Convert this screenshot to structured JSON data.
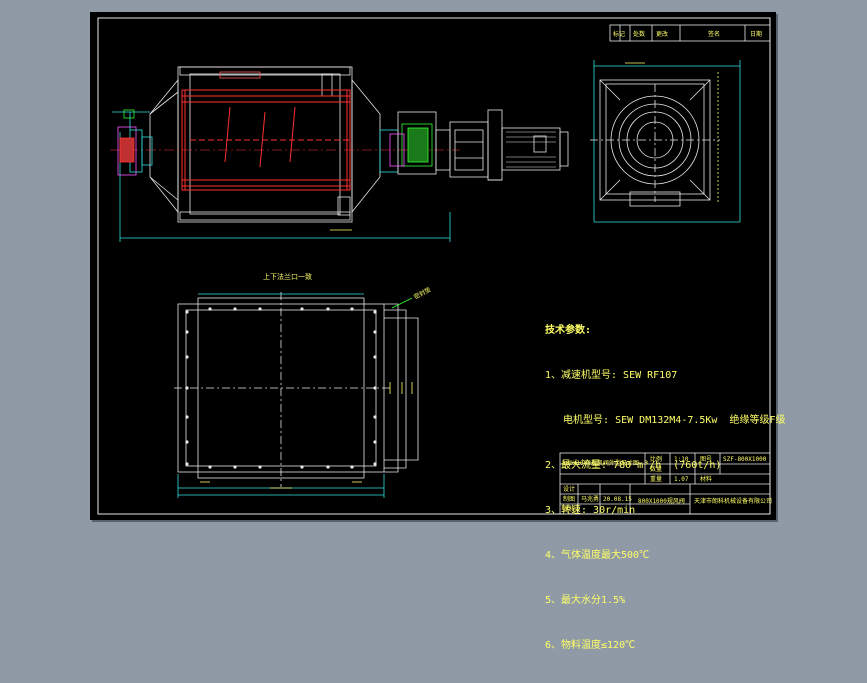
{
  "drawing": {
    "flange_caption": "上下法兰口一致",
    "seal_caption": "密封垫",
    "tech_params": {
      "title": "技术参数:",
      "lines": [
        "1、减速机型号: SEW RF107",
        "   电机型号: SEW DM132M4-7.5Kw  绝缘等级F级",
        "2、最大流量: 780 m³/h  (760t/h)",
        "3、转速: 30r/min",
        "4、气体温度最大500℃",
        "5、最大水分1.5%",
        "6、物料温度≤120℃"
      ]
    },
    "revision_block": {
      "c1": "标记",
      "c2": "处数",
      "c3": "更改",
      "c4": "签名",
      "c5": "日期"
    },
    "title_block": {
      "caption": "800X1000规风阀外型尺寸图",
      "scale_label": "比例",
      "scale_value": "1:10",
      "drawing_no_label": "图号",
      "drawing_no_value": "SZF-800X1000",
      "qty_label": "数量",
      "weight_label": "重量",
      "weight_value": "1.07",
      "material_label": "材料",
      "design_label": "设计",
      "draw_label": "制图",
      "draw_name": "马兆勇",
      "draw_date": "20.08.15",
      "check_label": "审核",
      "product_name": "800X1000规风阀",
      "company": "天津市朗科机械设备有限公司"
    }
  }
}
